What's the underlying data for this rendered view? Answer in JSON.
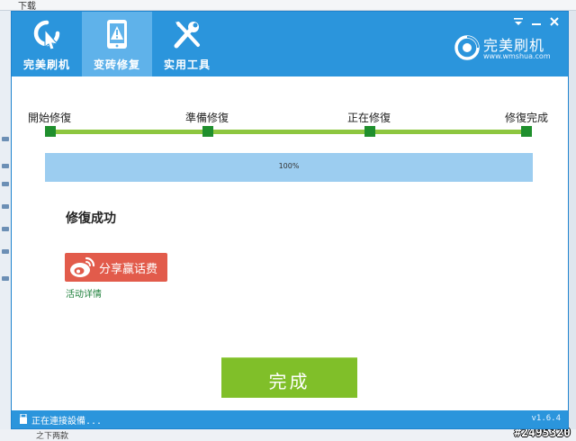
{
  "desktop": {
    "top_text": "下载",
    "bottom_text": "之下两款",
    "watermark": "#2495320"
  },
  "header": {
    "tabs": [
      {
        "label": "完美刷机",
        "icon": "refresh-arrow-icon",
        "active": false
      },
      {
        "label": "变砖修复",
        "icon": "warning-phone-icon",
        "active": true
      },
      {
        "label": "实用工具",
        "icon": "tools-icon",
        "active": false
      }
    ],
    "brand": {
      "name": "完美刷机",
      "url": "www.wmshua.com"
    },
    "window_controls": [
      "menu-icon",
      "minimize-icon",
      "close-icon"
    ]
  },
  "steps": [
    {
      "label": "開始修復"
    },
    {
      "label": "準備修復"
    },
    {
      "label": "正在修復"
    },
    {
      "label": "修復完成"
    }
  ],
  "progress": {
    "value": 1.0,
    "text": "100%"
  },
  "result": {
    "title": "修復成功"
  },
  "share": {
    "label": "分享赢话费",
    "link": "活动详情"
  },
  "done_button": {
    "label": "完成"
  },
  "status": {
    "text": "正在連接設備...",
    "version": "v1.6.4"
  },
  "colors": {
    "header_blue": "#2b95dc",
    "active_tab": "#5fb2ea",
    "step_green": "#8dc63f",
    "step_dot": "#1f8f2d",
    "progress_blue": "#9ccdf0",
    "share_red": "#e25b4b",
    "done_green": "#80bf29"
  }
}
